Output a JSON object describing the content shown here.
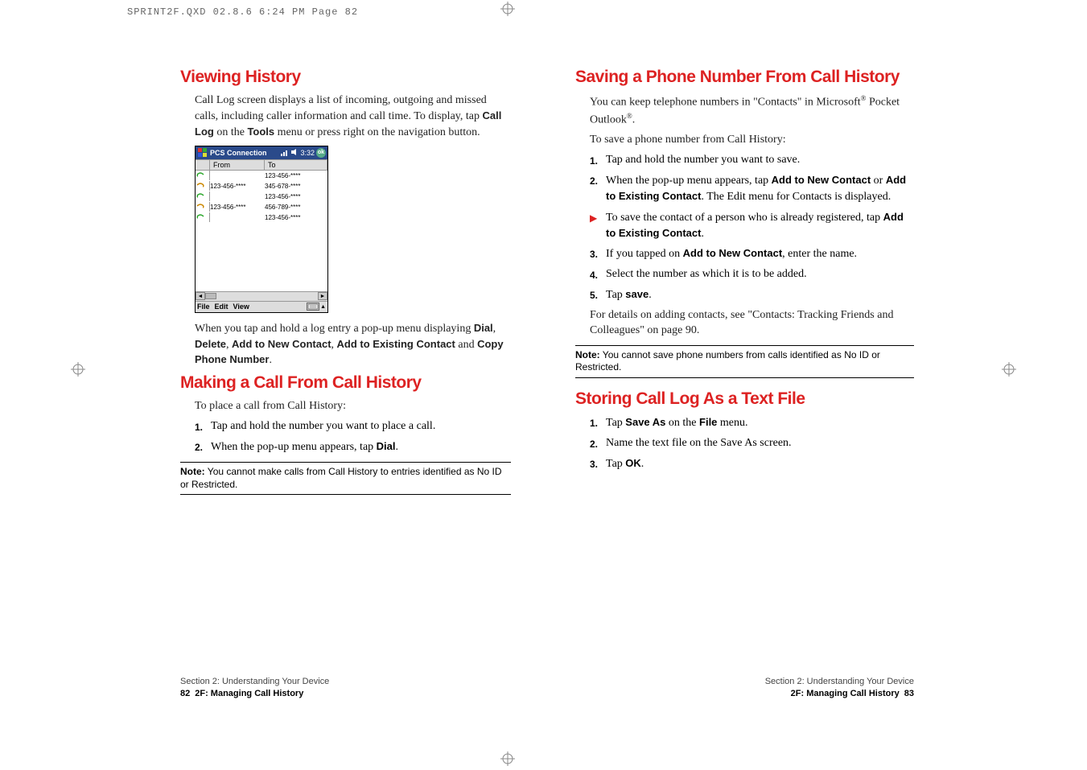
{
  "header_stamp": "SPRINT2F.QXD  02.8.6  6:24 PM  Page 82",
  "left": {
    "h1": "Viewing History",
    "p1_a": "Call Log screen displays a list of incoming, outgoing and missed calls, including caller information and call time. To display, tap ",
    "p1_b": "Call Log",
    "p1_c": " on the ",
    "p1_d": "Tools",
    "p1_e": " menu or press right on the navigation button.",
    "screenshot": {
      "title": "PCS Connection",
      "time": "3:32",
      "ok": "ok",
      "col_from": "From",
      "col_to": "To",
      "rows": [
        {
          "from": "",
          "to": "123-456-****"
        },
        {
          "from": "123-456-****",
          "to": "345-678-****"
        },
        {
          "from": "",
          "to": "123-456-****"
        },
        {
          "from": "123-456-****",
          "to": "456-789-****"
        },
        {
          "from": "",
          "to": "123-456-****"
        }
      ],
      "menu": [
        "File",
        "Edit",
        "View"
      ]
    },
    "p2_a": "When you tap and hold a log entry a pop-up menu displaying ",
    "p2_b": "Dial",
    "p2_c": ", ",
    "p2_d": "Delete",
    "p2_e": ", ",
    "p2_f": "Add to New Contact",
    "p2_g": ", ",
    "p2_h": "Add to Existing Contact",
    "p2_i": " and ",
    "p2_j": "Copy Phone Number",
    "p2_k": ".",
    "h2": "Making a Call From Call History",
    "p3": "To place a call from Call History:",
    "s1_n": "1.",
    "s1_t": "Tap and hold the number you want to place a call.",
    "s2_n": "2.",
    "s2_a": "When the pop-up menu appears, tap ",
    "s2_b": "Dial",
    "s2_c": ".",
    "note_label": "Note:",
    "note_text": " You cannot make calls from Call History to entries identified as No ID or Restricted.",
    "footer_section": "Section 2: Understanding Your Device",
    "footer_sub": "2F: Managing Call History",
    "footer_page": "82"
  },
  "right": {
    "h1": "Saving a Phone Number From Call History",
    "p1_a": "You can keep telephone numbers in \"Contacts\" in Microsoft",
    "p1_b": " Pocket Outlook",
    "p1_c": ".",
    "p2": "To save a phone number from Call History:",
    "s1_n": "1.",
    "s1_t": "Tap and hold the number you want to save.",
    "s2_n": "2.",
    "s2_a": "When the pop-up menu appears, tap ",
    "s2_b": "Add to New Contact",
    "s2_c": " or ",
    "s2_d": "Add to Existing Contact",
    "s2_e": ". The Edit menu for Contacts is displayed.",
    "b1_a": "To save the contact of a person who is already registered, tap ",
    "b1_b": "Add to Existing Contact",
    "b1_c": ".",
    "s3_n": "3.",
    "s3_a": "If you tapped on ",
    "s3_b": "Add to New Contact",
    "s3_c": ", enter the name.",
    "s4_n": "4.",
    "s4_t": "Select the number as which it is to be added.",
    "s5_n": "5.",
    "s5_a": "Tap ",
    "s5_b": "save",
    "s5_c": ".",
    "p3": "For details on adding contacts, see \"Contacts: Tracking Friends and Colleagues\" on page 90.",
    "note_label": "Note:",
    "note_text": " You cannot save phone numbers from calls identified as No ID or Restricted.",
    "h2": "Storing Call Log As a Text File",
    "t1_n": "1.",
    "t1_a": "Tap ",
    "t1_b": "Save As",
    "t1_c": " on the ",
    "t1_d": "File",
    "t1_e": " menu.",
    "t2_n": "2.",
    "t2_t": "Name the text file on the Save As screen.",
    "t3_n": "3.",
    "t3_a": "Tap ",
    "t3_b": "OK",
    "t3_c": ".",
    "footer_section": "Section 2: Understanding Your Device",
    "footer_sub": "2F: Managing Call History",
    "footer_page": "83"
  }
}
